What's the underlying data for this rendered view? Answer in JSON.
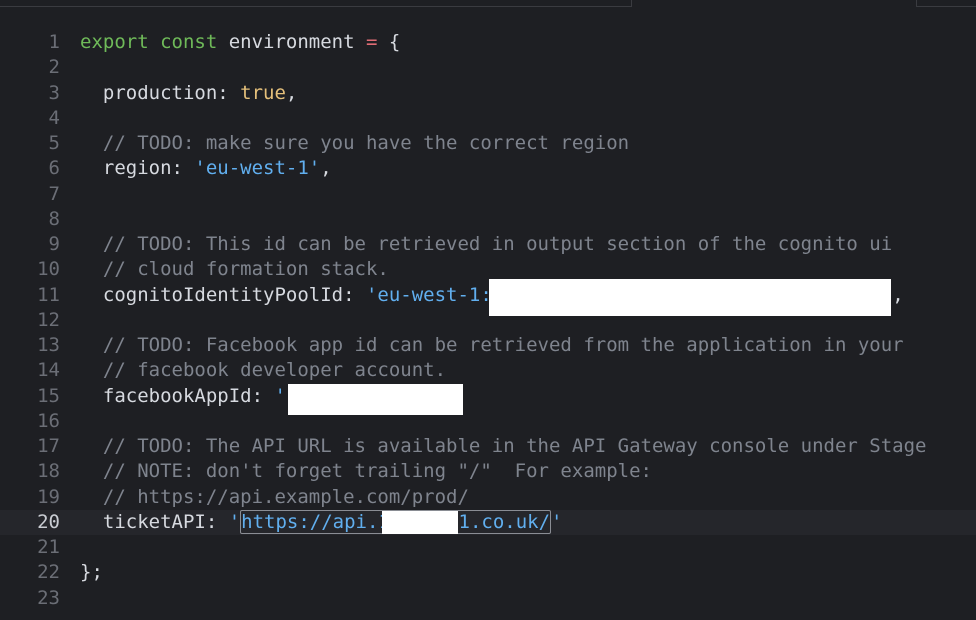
{
  "lines": [
    {
      "num": "1",
      "tokens": [
        [
          "kw",
          "export"
        ],
        [
          "ident",
          " "
        ],
        [
          "kw",
          "const"
        ],
        [
          "ident",
          " environment "
        ],
        [
          "op",
          "="
        ],
        [
          "punc",
          " {"
        ]
      ]
    },
    {
      "num": "2",
      "tokens": []
    },
    {
      "num": "3",
      "tokens": [
        [
          "ident",
          "  production: "
        ],
        [
          "bool",
          "true"
        ],
        [
          "punc",
          ","
        ]
      ]
    },
    {
      "num": "4",
      "tokens": []
    },
    {
      "num": "5",
      "tokens": [
        [
          "cmt",
          "  // TODO: make sure you have the correct region"
        ]
      ]
    },
    {
      "num": "6",
      "tokens": [
        [
          "ident",
          "  region: "
        ],
        [
          "str",
          "'eu-west-1'"
        ],
        [
          "punc",
          ","
        ]
      ]
    },
    {
      "num": "7",
      "tokens": []
    },
    {
      "num": "8",
      "tokens": []
    },
    {
      "num": "9",
      "tokens": [
        [
          "cmt",
          "  // TODO: This id can be retrieved in output section of the cognito ui"
        ]
      ]
    },
    {
      "num": "10",
      "tokens": [
        [
          "cmt",
          "  // cloud formation stack."
        ]
      ]
    },
    {
      "num": "11",
      "tokens": [
        [
          "ident",
          "  cognitoIdentityPoolId: "
        ],
        [
          "str",
          "'eu-west-1:                                 6'"
        ],
        [
          "punc",
          ","
        ]
      ]
    },
    {
      "num": "12",
      "tokens": []
    },
    {
      "num": "13",
      "tokens": [
        [
          "cmt",
          "  // TODO: Facebook app id can be retrieved from the application in your"
        ]
      ]
    },
    {
      "num": "14",
      "tokens": [
        [
          "cmt",
          "  // facebook developer account."
        ]
      ]
    },
    {
      "num": "15",
      "tokens": [
        [
          "ident",
          "  facebookAppId: "
        ],
        [
          "str",
          "'1            "
        ],
        [
          "punc",
          ","
        ]
      ]
    },
    {
      "num": "16",
      "tokens": []
    },
    {
      "num": "17",
      "tokens": [
        [
          "cmt",
          "  // TODO: The API URL is available in the API Gateway console under Stage"
        ]
      ]
    },
    {
      "num": "18",
      "tokens": [
        [
          "cmt",
          "  // NOTE: don't forget trailing \"/\"  For example:"
        ]
      ]
    },
    {
      "num": "19",
      "tokens": [
        [
          "cmt",
          "  // https://api.example.com/prod/"
        ]
      ]
    },
    {
      "num": "20",
      "tokens": [
        [
          "ident",
          "  ticketAPI: "
        ],
        [
          "str",
          "'"
        ],
        [
          "url",
          "https://api.1      1.co.uk/"
        ],
        [
          "str",
          "'"
        ]
      ]
    },
    {
      "num": "21",
      "tokens": []
    },
    {
      "num": "22",
      "tokens": [
        [
          "punc",
          "};"
        ]
      ]
    },
    {
      "num": "23",
      "tokens": []
    }
  ],
  "current_line": "20"
}
